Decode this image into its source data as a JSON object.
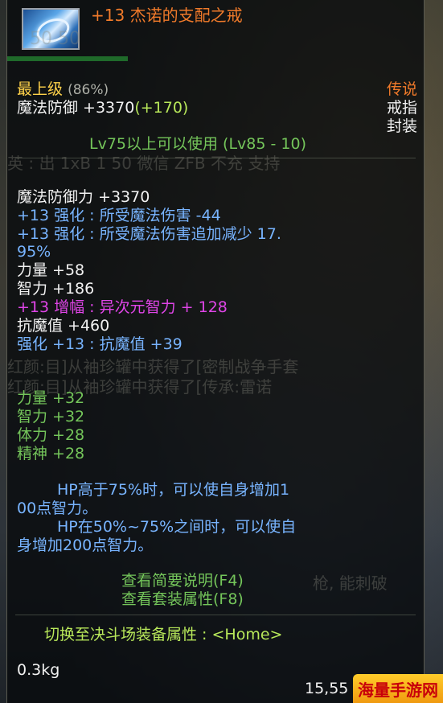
{
  "item": {
    "title": "+13 杰诺的支配之戒",
    "grade": "最上级",
    "grade_pct": "(86%)",
    "rarity": "传说",
    "type": "戒指",
    "seal": "封装",
    "base_stat": "魔法防御 +3370",
    "base_bonus": "(+170)",
    "requirement": "Lv75以上可以使用 (Lv85 - 10)",
    "weight": "0.3kg",
    "price": "15,55"
  },
  "stats": {
    "mdef": "魔法防御力 +3370",
    "reinforce_1": "+13 强化 : 所受魔法伤害 -44",
    "reinforce_2a": "+13 强化 : 所受魔法伤害追加减少 17.",
    "reinforce_2b": "95%",
    "str": "力量 +58",
    "int": "智力 +186",
    "amplify": "+13 增幅 : 异次元智力 + 128",
    "resist": "抗魔值 +460",
    "resist_reinforce": "强化 +13 : 抗魔值 +39"
  },
  "set_bonus": [
    "力量 +32",
    "智力 +32",
    "体力 +28",
    "精神 +28"
  ],
  "effect": {
    "line1": "HP高于75%时，可以使自身增加1",
    "line2": "00点智力。",
    "line3": "HP在50%~75%之间时，可以使自",
    "line4": "身增加200点智力。"
  },
  "actions": {
    "brief": "查看简要说明(F4)",
    "set": "查看套装属性(F8)",
    "switch": "切换至决斗场装备属性 : <Home>"
  },
  "watermark": "海量手游网",
  "colors": {
    "gold": "#ffd24a",
    "legend": "#f07a2a",
    "blue": "#78b4ff",
    "set_green": "#74c55a",
    "amplify_magenta": "#e045e8"
  }
}
